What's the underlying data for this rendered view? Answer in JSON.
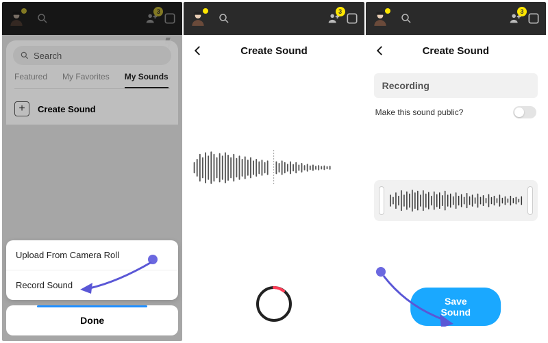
{
  "topbar": {
    "badge": "3"
  },
  "p1": {
    "search_placeholder": "Search",
    "tabs": {
      "featured": "Featured",
      "favorites": "My Favorites",
      "mysounds": "My Sounds"
    },
    "create_label": "Create Sound",
    "action": {
      "upload": "Upload From Camera Roll",
      "record": "Record Sound",
      "done": "Done"
    }
  },
  "p2": {
    "title": "Create Sound"
  },
  "p3": {
    "title": "Create Sound",
    "recording_label": "Recording",
    "public_label": "Make this sound public?",
    "save_label": "Save Sound"
  }
}
